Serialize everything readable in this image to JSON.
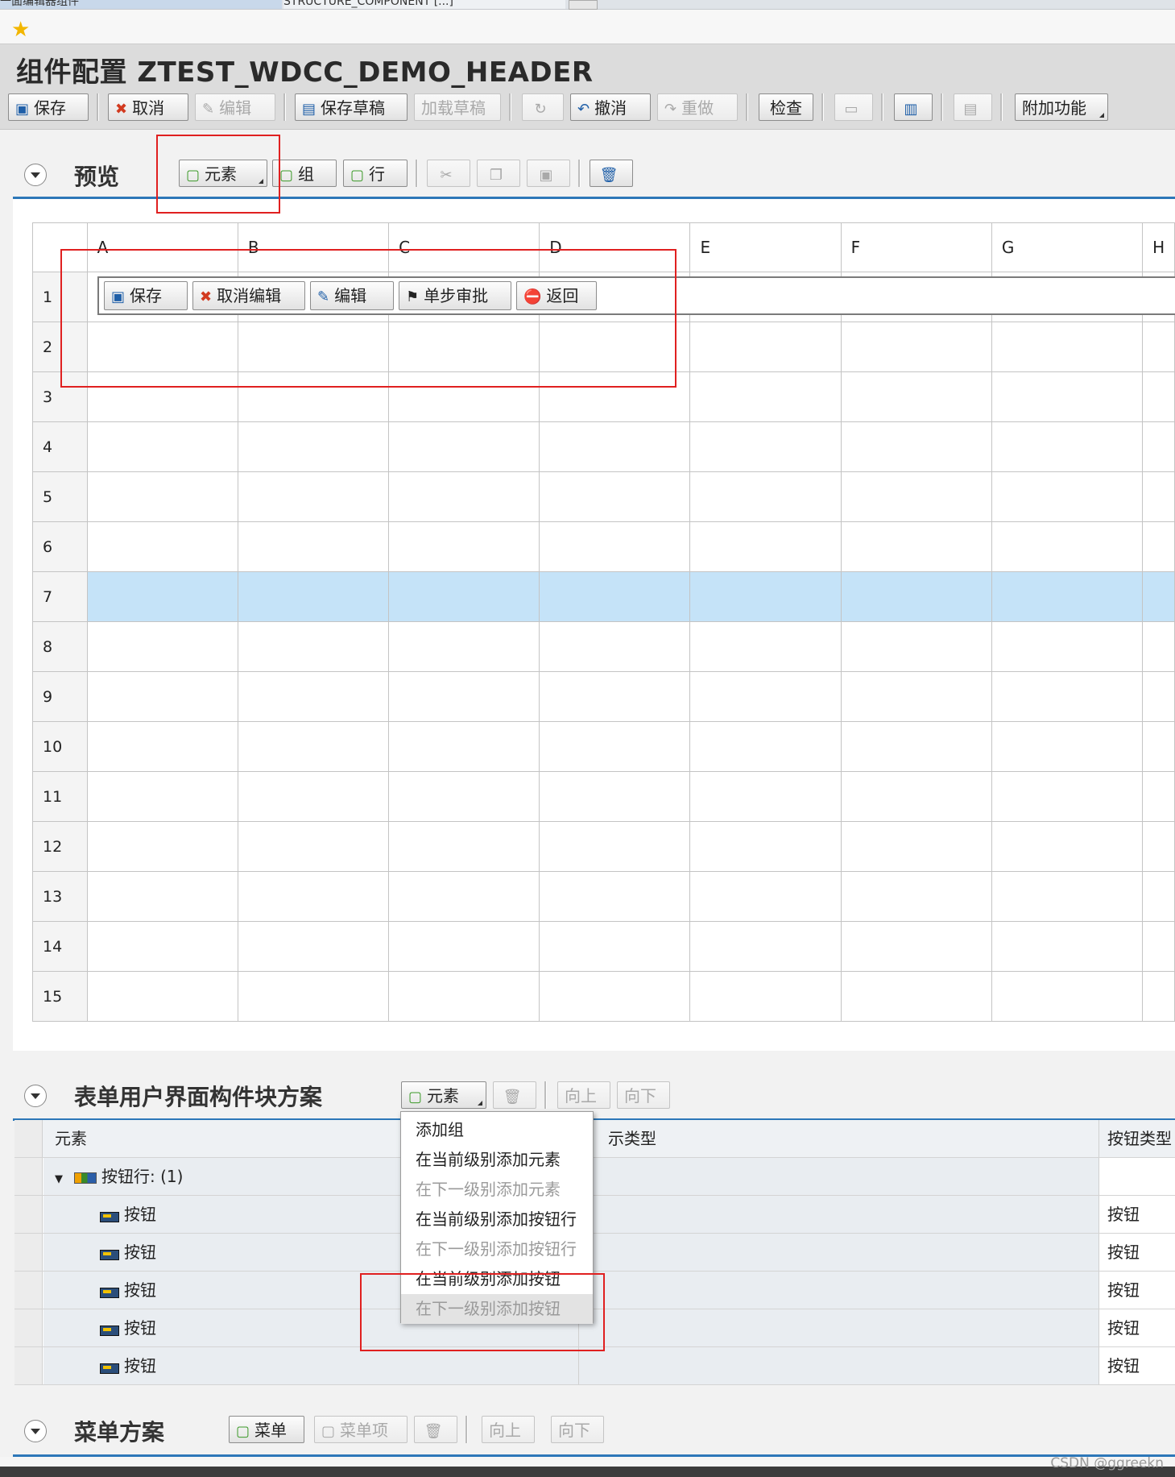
{
  "browser": {
    "tab1": "一面编辑器组件",
    "tab2": "STRUCTURE_COMPONENT [...]"
  },
  "header": {
    "title": "组件配置 ZTEST_WDCC_DEMO_HEADER"
  },
  "toolbar": {
    "save": "保存",
    "cancel": "取消",
    "edit": "编辑",
    "save_draft": "保存草稿",
    "load_draft": "加载草稿",
    "undo": "撤消",
    "redo": "重做",
    "check": "检查",
    "extra": "附加功能"
  },
  "preview": {
    "title": "预览",
    "btn_element": "元素",
    "btn_group": "组",
    "btn_row": "行",
    "columns": [
      "A",
      "B",
      "C",
      "D",
      "E",
      "F",
      "G",
      "H"
    ],
    "rows": [
      "1",
      "2",
      "3",
      "4",
      "5",
      "6",
      "7",
      "8",
      "9",
      "10",
      "11",
      "12",
      "13",
      "14",
      "15"
    ],
    "selected_row": "7",
    "row1_buttons": {
      "save": "保存",
      "cancel_edit": "取消编辑",
      "edit": "编辑",
      "single_approve": "单步审批",
      "back": "返回"
    }
  },
  "form": {
    "title": "表单用户界面构件块方案",
    "btn_element": "元素",
    "btn_up": "向上",
    "btn_down": "向下",
    "col_element": "元素",
    "col_display_type": "示类型",
    "col_button_type": "按钮类型",
    "group_row": "按钮行: (1)",
    "rows": [
      {
        "element": "按钮",
        "button_type": "按钮"
      },
      {
        "element": "按钮",
        "button_type": "按钮"
      },
      {
        "element": "按钮",
        "button_type": "按钮"
      },
      {
        "element": "按钮",
        "button_type": "按钮"
      },
      {
        "element": "按钮",
        "button_type": "按钮"
      }
    ]
  },
  "dropdown_menu": {
    "items": [
      {
        "label": "添加组",
        "enabled": true
      },
      {
        "label": "在当前级别添加元素",
        "enabled": true
      },
      {
        "label": "在下一级别添加元素",
        "enabled": false
      },
      {
        "label": "在当前级别添加按钮行",
        "enabled": true
      },
      {
        "label": "在下一级别添加按钮行",
        "enabled": false
      },
      {
        "label": "在当前级别添加按钮",
        "enabled": true
      },
      {
        "label": "在下一级别添加按钮",
        "enabled": false
      }
    ]
  },
  "menu_scheme": {
    "title": "菜单方案",
    "btn_menu": "菜单",
    "btn_menu_item": "菜单项",
    "btn_up": "向上",
    "btn_down": "向下"
  },
  "watermark": "CSDN @ggreekn",
  "colors": {
    "accent": "#2d77b8",
    "selected_row": "#c5e3f8",
    "highlight_box": "#e02020"
  }
}
